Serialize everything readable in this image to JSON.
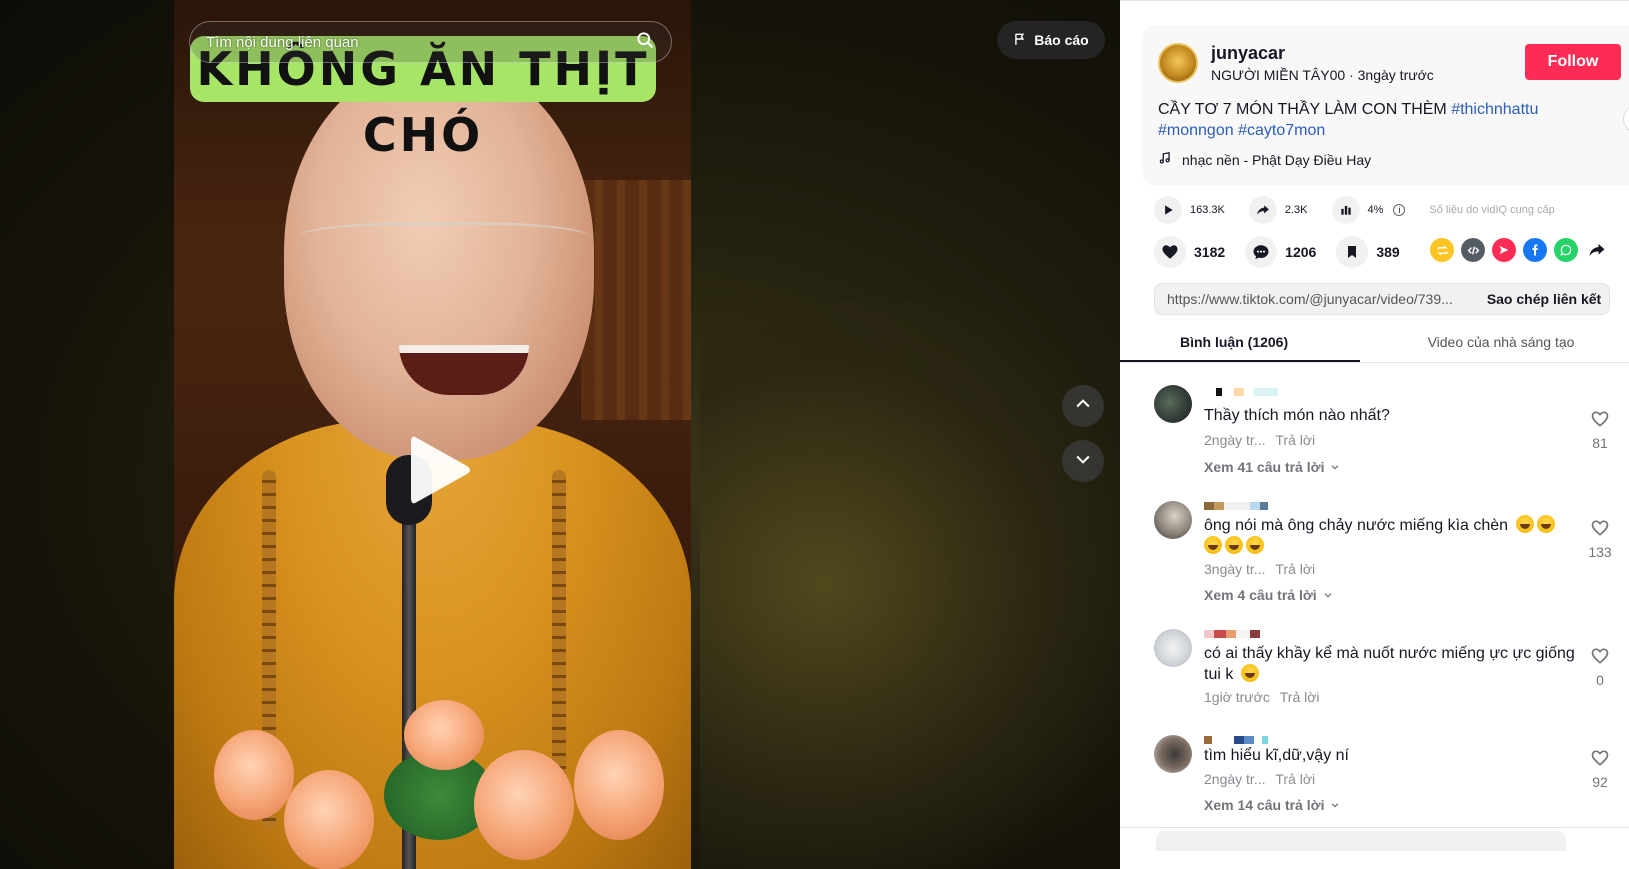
{
  "video": {
    "search_placeholder": "Tìm nội dung liên quan",
    "overlay_title": "KHÔNG ĂN THỊT CHÓ",
    "report_label": "Báo cáo"
  },
  "post": {
    "username": "junyacar",
    "display_name": "NGƯỜI MIỀN TÂY00",
    "time_ago": "3ngày trước",
    "follow_label": "Follow",
    "caption_text": "CẦY TƠ 7 MÓN THẦY LÀM CON THÈM ",
    "hashtags": [
      "#thichnhattu",
      "#monngon",
      "#cayto7mon"
    ],
    "music": "nhạc nền - Phật Dạy Điều Hay"
  },
  "stats": {
    "plays": "163.3K",
    "shares": "2.3K",
    "engagement": "4%",
    "source_note": "Số liệu do vidIQ cung cấp"
  },
  "actions": {
    "likes": "3182",
    "comments": "1206",
    "saves": "389"
  },
  "share_icons": [
    "repost-icon",
    "embed-icon",
    "send-icon",
    "facebook-icon",
    "whatsapp-icon",
    "share-arrow-icon"
  ],
  "link": {
    "url": "https://www.tiktok.com/@junyacar/video/739...",
    "copy_label": "Sao chép liên kết"
  },
  "tabs": {
    "comments": "Bình luận (1206)",
    "creator_videos": "Video của nhà sáng tạo"
  },
  "comments": [
    {
      "text": "Thầy thích món nào nhất?",
      "time": "2ngày tr...",
      "reply": "Trả lời",
      "replies_label": "Xem 41 câu trả lời",
      "likes": "81"
    },
    {
      "text_line1": "ông nói mà ông chảy nước miếng kìa chèn",
      "time": "3ngày tr...",
      "reply": "Trả lời",
      "replies_label": "Xem 4 câu trả lời",
      "likes": "133"
    },
    {
      "text_line1": "có ai thấy khầy kể mà nuốt nước miếng ực ực giống",
      "text_line2": "tui k",
      "time": "1giờ trước",
      "reply": "Trả lời",
      "likes": "0"
    },
    {
      "text": "tìm hiểu kĩ,dữ,vậy ní",
      "time": "2ngày tr...",
      "reply": "Trả lời",
      "replies_label": "Xem 14 câu trả lời",
      "likes": "92"
    }
  ],
  "colors": {
    "follow": "#fe2c55",
    "hashtag": "#2b5db9",
    "overlay_bg": "#a6e566"
  }
}
